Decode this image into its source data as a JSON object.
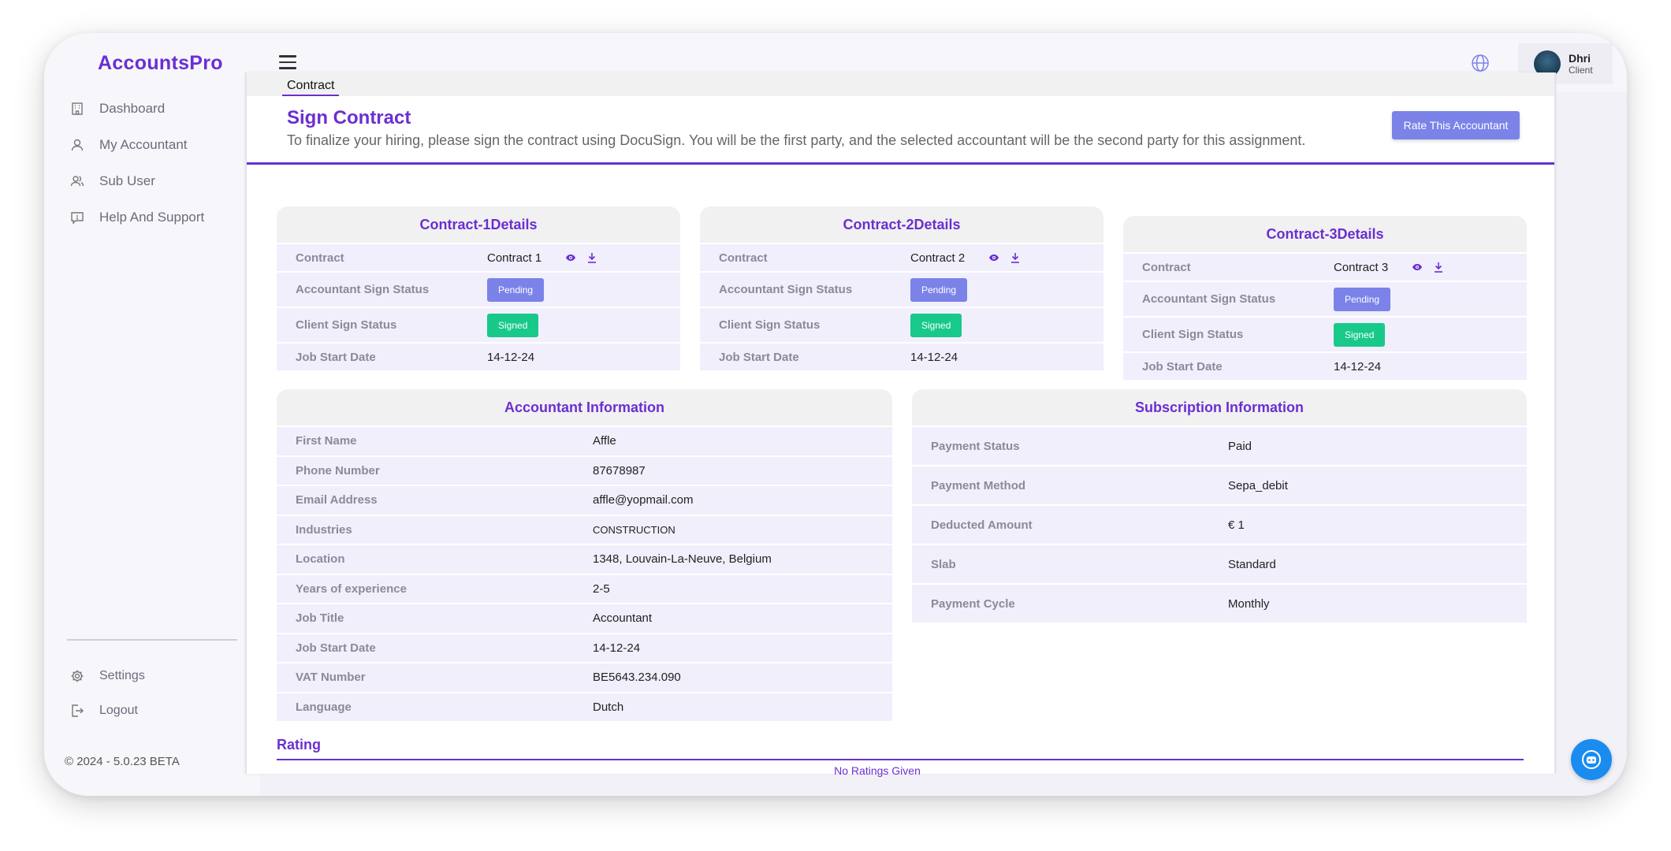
{
  "app": {
    "logo": "AccountsPro"
  },
  "sidebar": {
    "items": [
      {
        "label": "Dashboard",
        "icon": "building-icon"
      },
      {
        "label": "My Accountant",
        "icon": "user-icon"
      },
      {
        "label": "Sub User",
        "icon": "users-icon"
      },
      {
        "label": "Help And Support",
        "icon": "help-icon"
      }
    ],
    "bottom_items": [
      {
        "label": "Settings",
        "icon": "gear-icon"
      },
      {
        "label": "Logout",
        "icon": "logout-icon"
      }
    ],
    "copyright": "© 2024 - 5.0.23 BETA"
  },
  "header": {
    "user": {
      "name": "Dhri",
      "role": "Client"
    }
  },
  "page": {
    "tab": "Contract",
    "title": "Sign Contract",
    "description": "To finalize your hiring, please sign the contract using DocuSign. You will be the first party, and the selected accountant will be the second party for this assignment.",
    "rate_button": "Rate This Accountant"
  },
  "contracts": [
    {
      "title": "Contract-1Details",
      "rows": {
        "contract_label": "Contract",
        "contract_value": "Contract 1",
        "acc_label": "Accountant Sign Status",
        "acc_value": "Pending",
        "client_label": "Client Sign Status",
        "client_value": "Signed",
        "date_label": "Job Start Date",
        "date_value": "14-12-24"
      }
    },
    {
      "title": "Contract-2Details",
      "rows": {
        "contract_label": "Contract",
        "contract_value": "Contract 2",
        "acc_label": "Accountant Sign Status",
        "acc_value": "Pending",
        "client_label": "Client Sign Status",
        "client_value": "Signed",
        "date_label": "Job Start Date",
        "date_value": "14-12-24"
      }
    },
    {
      "title": "Contract-3Details",
      "rows": {
        "contract_label": "Contract",
        "contract_value": "Contract 3",
        "acc_label": "Accountant Sign Status",
        "acc_value": "Pending",
        "client_label": "Client Sign Status",
        "client_value": "Signed",
        "date_label": "Job Start Date",
        "date_value": "14-12-24"
      }
    }
  ],
  "accountant": {
    "title": "Accountant Information",
    "rows": [
      {
        "label": "First Name",
        "value": "Affle"
      },
      {
        "label": "Phone Number",
        "value": "87678987"
      },
      {
        "label": "Email Address",
        "value": "affle@yopmail.com"
      },
      {
        "label": "Industries",
        "value": "CONSTRUCTION"
      },
      {
        "label": "Location",
        "value": "1348, Louvain-La-Neuve, Belgium"
      },
      {
        "label": "Years of experience",
        "value": "2-5"
      },
      {
        "label": "Job Title",
        "value": "Accountant"
      },
      {
        "label": "Job Start Date",
        "value": "14-12-24"
      },
      {
        "label": "VAT Number",
        "value": "BE5643.234.090"
      },
      {
        "label": "Language",
        "value": "Dutch"
      }
    ]
  },
  "subscription": {
    "title": "Subscription Information",
    "rows": [
      {
        "label": "Payment Status",
        "value": "Paid"
      },
      {
        "label": "Payment Method",
        "value": "Sepa_debit"
      },
      {
        "label": "Deducted Amount",
        "value": "€ 1"
      },
      {
        "label": "Slab",
        "value": "Standard"
      },
      {
        "label": "Payment Cycle",
        "value": "Monthly"
      }
    ]
  },
  "rating": {
    "title": "Rating",
    "empty_text": "No Ratings Given"
  },
  "colors": {
    "accent": "#6a2fd2",
    "pending": "#7b83e8",
    "signed": "#18c98a",
    "chat": "#1a8cf0"
  }
}
